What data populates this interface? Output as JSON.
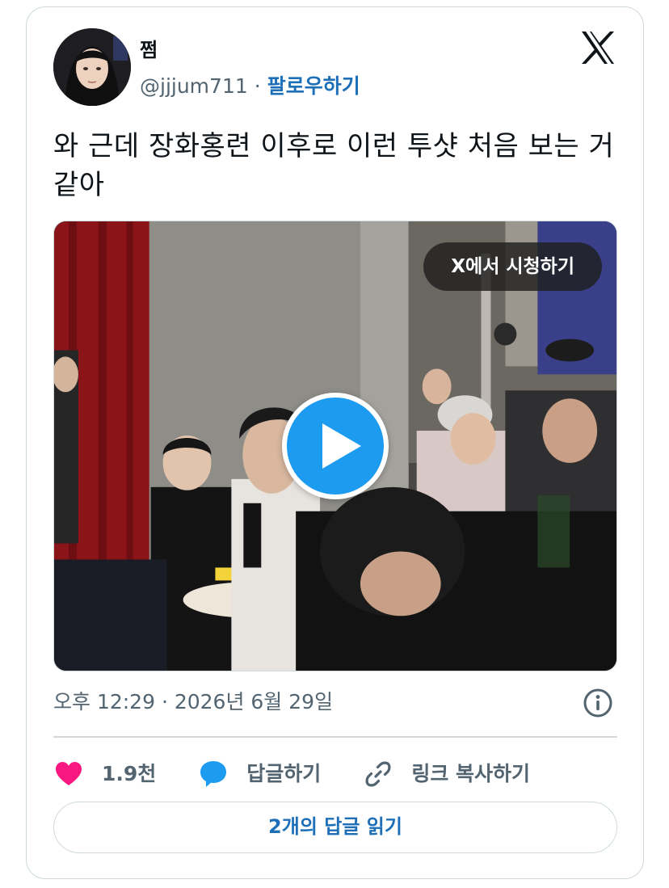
{
  "tweet": {
    "display_name": "쩜",
    "handle": "@jjjum711",
    "separator": "·",
    "follow_label": "팔로우하기",
    "text": "와 근데 장화홍련 이후로 이런 투샷 처음 보는 거 같아",
    "timestamp": "오후 12:29 · 2026년 6월 29일"
  },
  "media": {
    "watch_label": "X에서 시청하기"
  },
  "actions": {
    "like_count": "1.9천",
    "reply_label": "답글하기",
    "copy_link_label": "링크 복사하기",
    "read_replies_label": "2개의 답글 읽기"
  },
  "colors": {
    "accent": "#1d9bf0",
    "like": "#f91880",
    "text_secondary": "#536471",
    "border": "#cfd9de"
  },
  "icons": {
    "logo": "x-logo-icon",
    "info": "info-icon",
    "like": "heart-icon",
    "reply": "speech-bubble-icon",
    "link": "link-icon",
    "play": "play-icon"
  }
}
